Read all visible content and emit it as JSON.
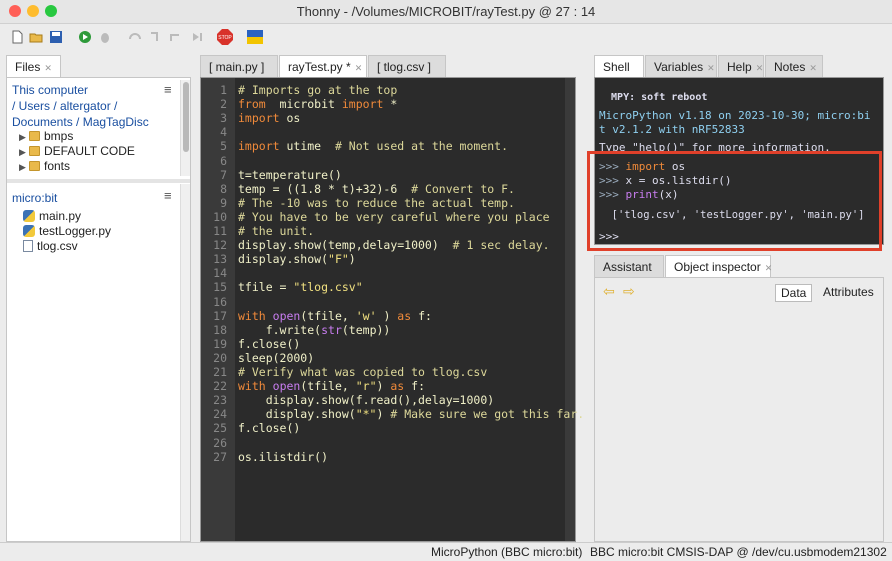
{
  "window": {
    "title": "Thonny  -  /Volumes/MICROBIT/rayTest.py  @  27 : 14",
    "traffic_colors": [
      "#ff5f57",
      "#febc2e",
      "#28c840"
    ]
  },
  "toolbar": {
    "icons": [
      "new-file-icon",
      "open-file-icon",
      "save-icon",
      "run-icon",
      "debug-icon",
      "step-over-icon",
      "step-into-icon",
      "step-out-icon",
      "resume-icon",
      "stop-icon",
      "flag-icon"
    ],
    "stop_label": "STOP"
  },
  "files_panel": {
    "tab_label": "Files",
    "computer_header": "This computer",
    "path_line1": "/ Users / altergator /",
    "path_line2": "Documents / MagTagDisc",
    "computer_items": [
      {
        "label": "bmps"
      },
      {
        "label": "DEFAULT CODE"
      },
      {
        "label": "fonts"
      }
    ],
    "device_header": "micro:bit",
    "device_items": [
      {
        "label": "main.py",
        "type": "python"
      },
      {
        "label": "testLogger.py",
        "type": "python"
      },
      {
        "label": "tlog.csv",
        "type": "file"
      }
    ]
  },
  "editor": {
    "tabs": [
      {
        "label": "[ main.py ]",
        "active": false
      },
      {
        "label": "rayTest.py *",
        "active": true
      },
      {
        "label": "[ tlog.csv ]",
        "active": false
      }
    ],
    "line_numbers": [
      "1",
      "2",
      "3",
      "4",
      "5",
      "6",
      "7",
      "8",
      "9",
      "10",
      "11",
      "12",
      "13",
      "14",
      "15",
      "16",
      "17",
      "18",
      "19",
      "20",
      "21",
      "22",
      "23",
      "24",
      "25",
      "26",
      "27"
    ]
  },
  "shell_panel": {
    "tabs": [
      {
        "label": "Shell",
        "active": true
      },
      {
        "label": "Variables",
        "active": false
      },
      {
        "label": "Help",
        "active": false
      },
      {
        "label": "Notes",
        "active": false
      }
    ],
    "lines": {
      "l1": "  MPY: soft reboot",
      "l2": "MicroPython v1.18 on 2023-10-30; micro:bi",
      "l3": "t v2.1.2 with nRF52833",
      "l4": "Type \"help()\" for more information.",
      "p1": ">>> ",
      "c1": "import",
      "c1b": " os",
      "p2": ">>> ",
      "c2": "x = os.listdir()",
      "p3": ">>> ",
      "c3": "print",
      "c3b": "(x)",
      "out": "  ['tlog.csv', 'testLogger.py', 'main.py']",
      "p4": ">>>"
    }
  },
  "inspector_panel": {
    "tabs": [
      {
        "label": "Assistant",
        "active": false
      },
      {
        "label": "Object inspector",
        "active": true
      }
    ],
    "data_button": "Data",
    "attributes_button": "Attributes"
  },
  "statusbar": {
    "interpreter": "MicroPython (BBC micro:bit)",
    "port": "BBC micro:bit CMSIS-DAP @ /dev/cu.usbmodem21302"
  },
  "colors": {
    "editor_bg": "#2b2b2b",
    "keyword": "#f08a3a",
    "highlight_box": "#e0402a"
  }
}
